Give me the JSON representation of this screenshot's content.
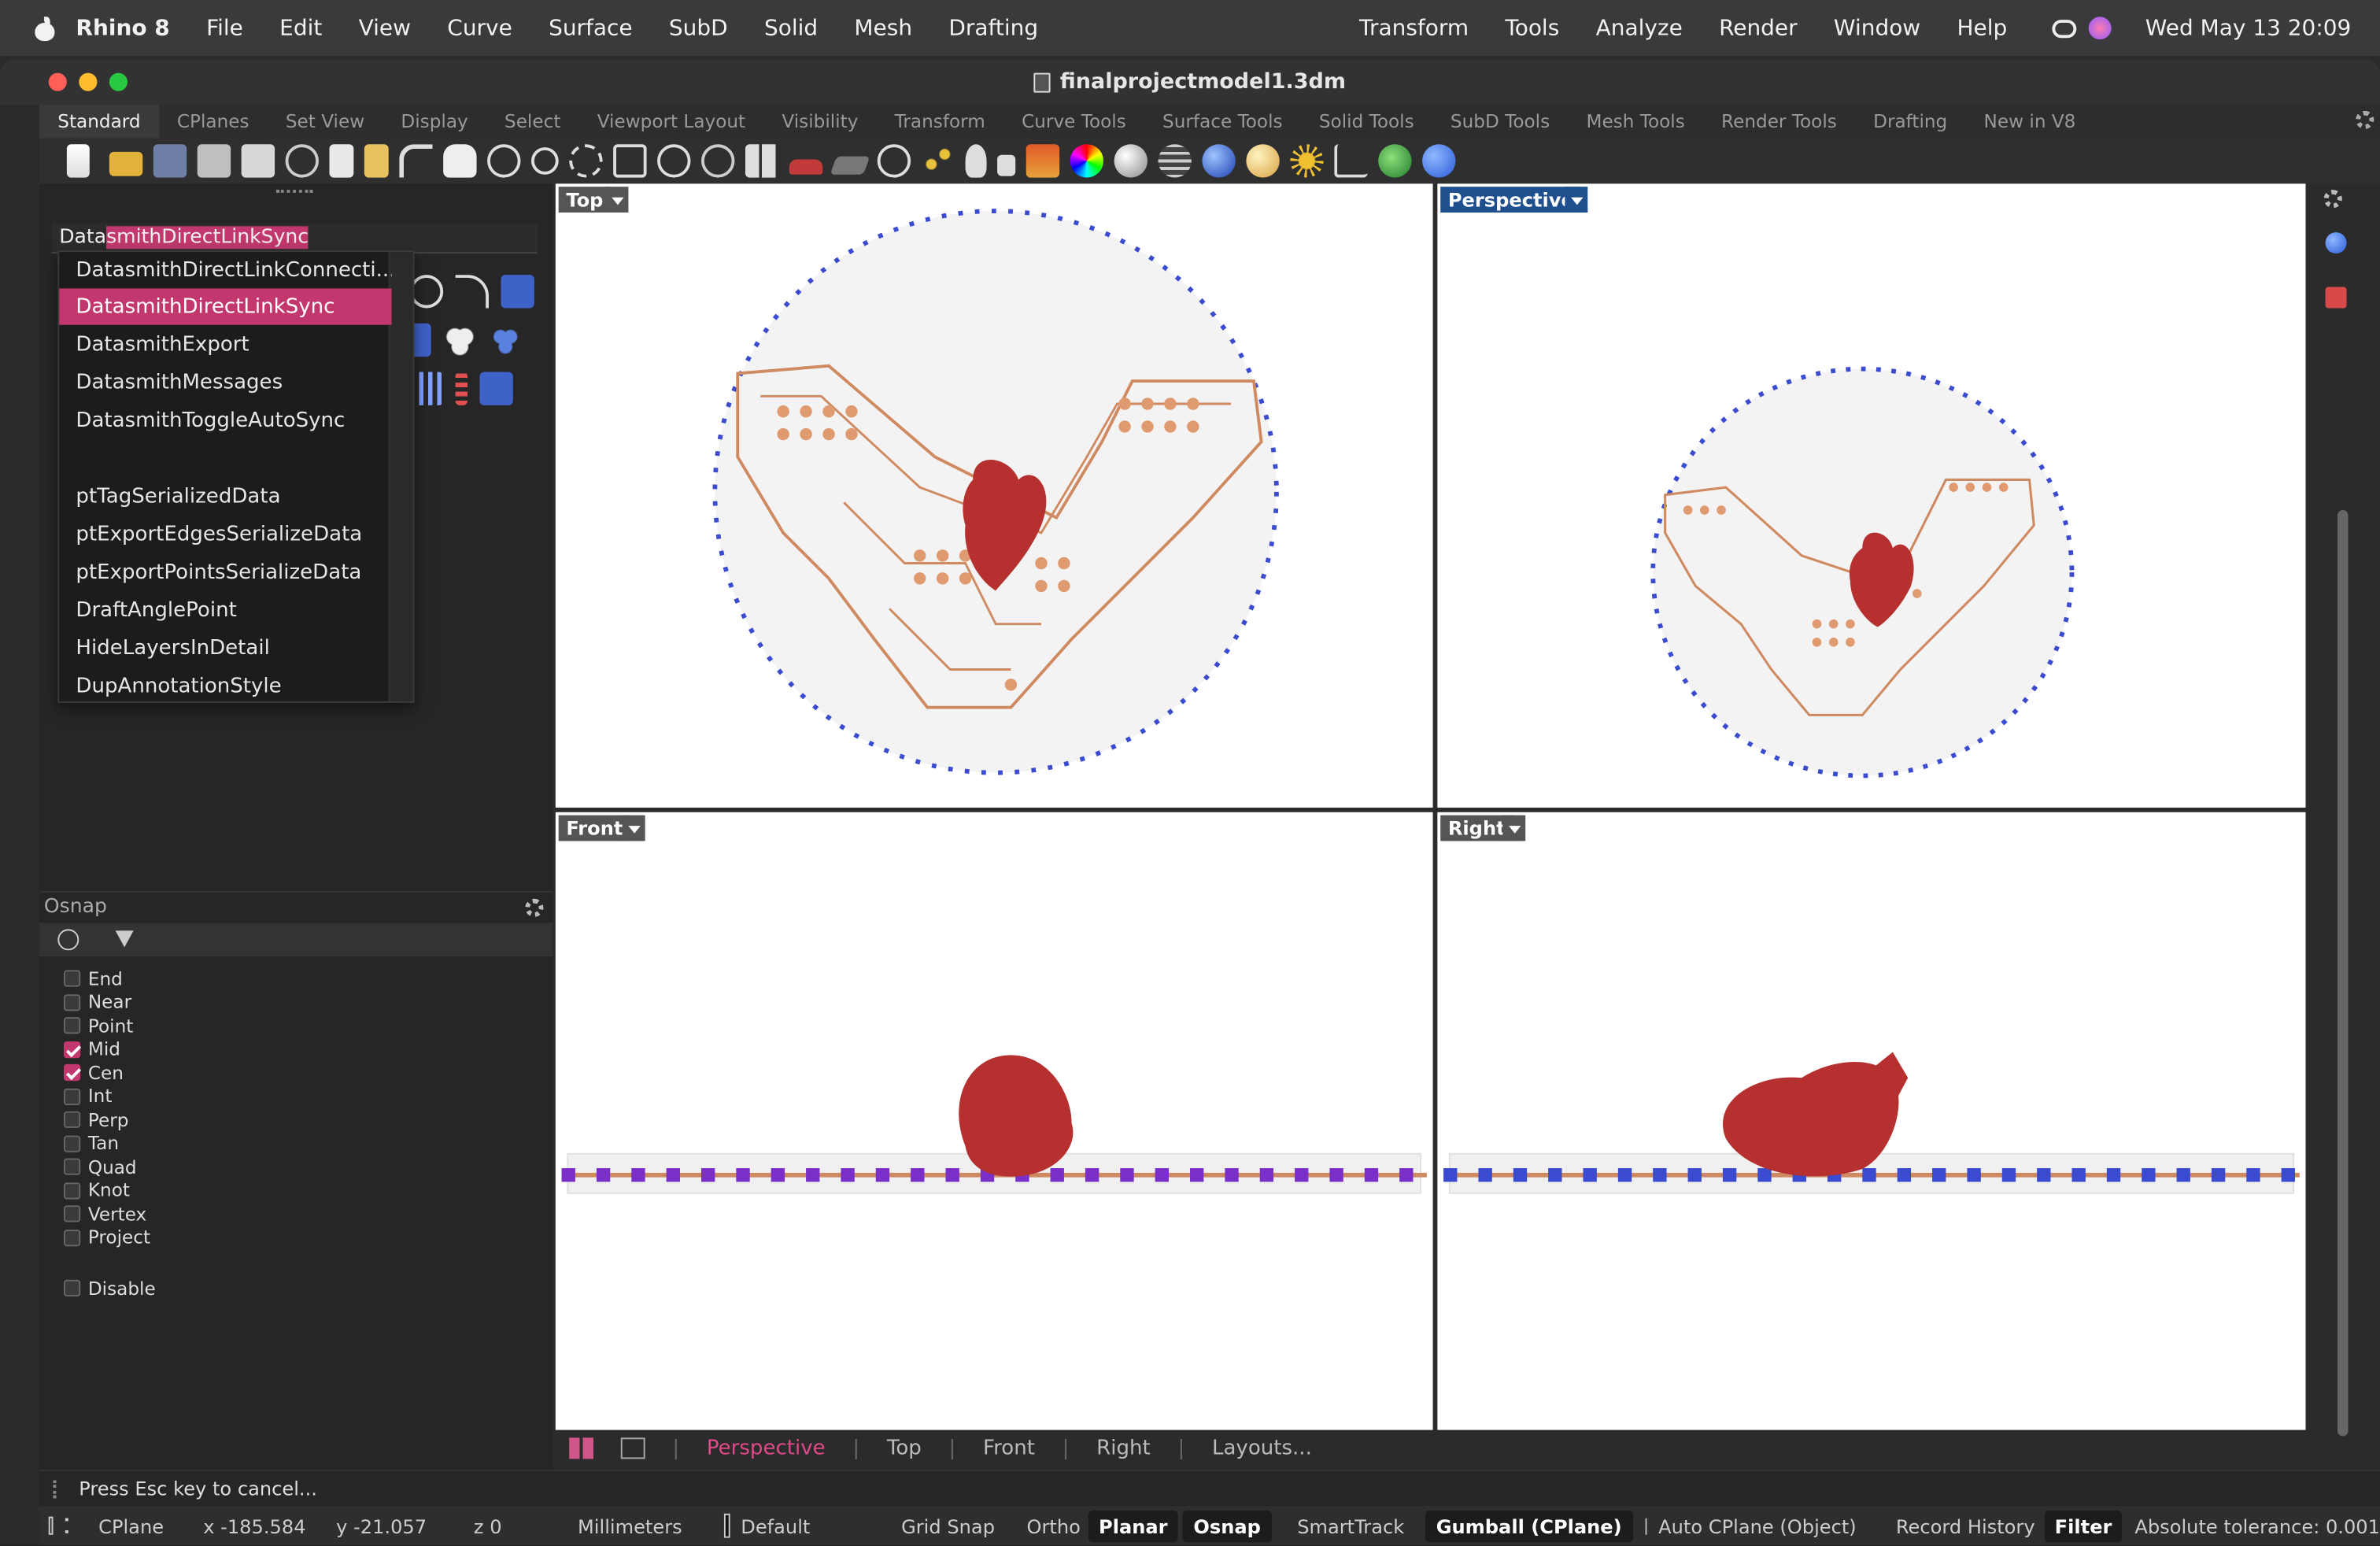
{
  "menubar": {
    "app": "Rhino 8",
    "items": [
      "File",
      "Edit",
      "View",
      "Curve",
      "Surface",
      "SubD",
      "Solid",
      "Mesh",
      "Drafting"
    ],
    "right_items": [
      "Transform",
      "Tools",
      "Analyze",
      "Render",
      "Window",
      "Help"
    ],
    "clock": "Wed May 13  20:09"
  },
  "window": {
    "title": "finalprojectmodel1.3dm"
  },
  "toolbar_tabs": [
    "Standard",
    "CPlanes",
    "Set View",
    "Display",
    "Select",
    "Viewport Layout",
    "Visibility",
    "Transform",
    "Curve Tools",
    "Surface Tools",
    "Solid Tools",
    "SubD Tools",
    "Mesh Tools",
    "Render Tools",
    "Drafting",
    "New in V8"
  ],
  "command": {
    "typed": "Data",
    "autocomplete": "smithDirectLinkSync"
  },
  "dropdown": {
    "items": [
      "DatasmithDirectLinkConnecti...",
      "DatasmithDirectLinkSync",
      "DatasmithExport",
      "DatasmithMessages",
      "DatasmithToggleAutoSync",
      "",
      "ptTagSerializedData",
      "ptExportEdgesSerializeData",
      "ptExportPointsSerializeData",
      "DraftAnglePoint",
      "HideLayersInDetail",
      "DupAnnotationStyle"
    ],
    "highlighted_index": 1
  },
  "osnap": {
    "title": "Osnap",
    "items": [
      {
        "label": "End",
        "checked": false
      },
      {
        "label": "Near",
        "checked": false
      },
      {
        "label": "Point",
        "checked": false
      },
      {
        "label": "Mid",
        "checked": true
      },
      {
        "label": "Cen",
        "checked": true
      },
      {
        "label": "Int",
        "checked": false
      },
      {
        "label": "Perp",
        "checked": false
      },
      {
        "label": "Tan",
        "checked": false
      },
      {
        "label": "Quad",
        "checked": false
      },
      {
        "label": "Knot",
        "checked": false
      },
      {
        "label": "Vertex",
        "checked": false
      },
      {
        "label": "Project",
        "checked": false
      }
    ],
    "disable": {
      "label": "Disable",
      "checked": false
    }
  },
  "viewports": {
    "top": "Top",
    "perspective": "Perspective",
    "front": "Front",
    "right": "Right"
  },
  "bottom_tabs": [
    "Perspective",
    "Top",
    "Front",
    "Right",
    "Layouts..."
  ],
  "command_prompt": "Press Esc key to cancel...",
  "status": {
    "cplane": "CPlane",
    "x": "x -185.584",
    "y": "y -21.057",
    "z": "z 0",
    "units": "Millimeters",
    "layer": "Default",
    "grid_snap": "Grid Snap",
    "ortho": "Ortho",
    "planar": "Planar",
    "osnap": "Osnap",
    "smarttrack": "SmartTrack",
    "gumball": "Gumball (CPlane)",
    "auto_cplane": "Auto CPlane (Object)",
    "record_history": "Record History",
    "filter": "Filter",
    "tolerance": "Absolute tolerance: 0.001"
  },
  "colors": {
    "accent": "#c2386e",
    "active_viewport": "#1f4f8c",
    "heart": "#b5302e",
    "circuit": "#d08a62"
  }
}
